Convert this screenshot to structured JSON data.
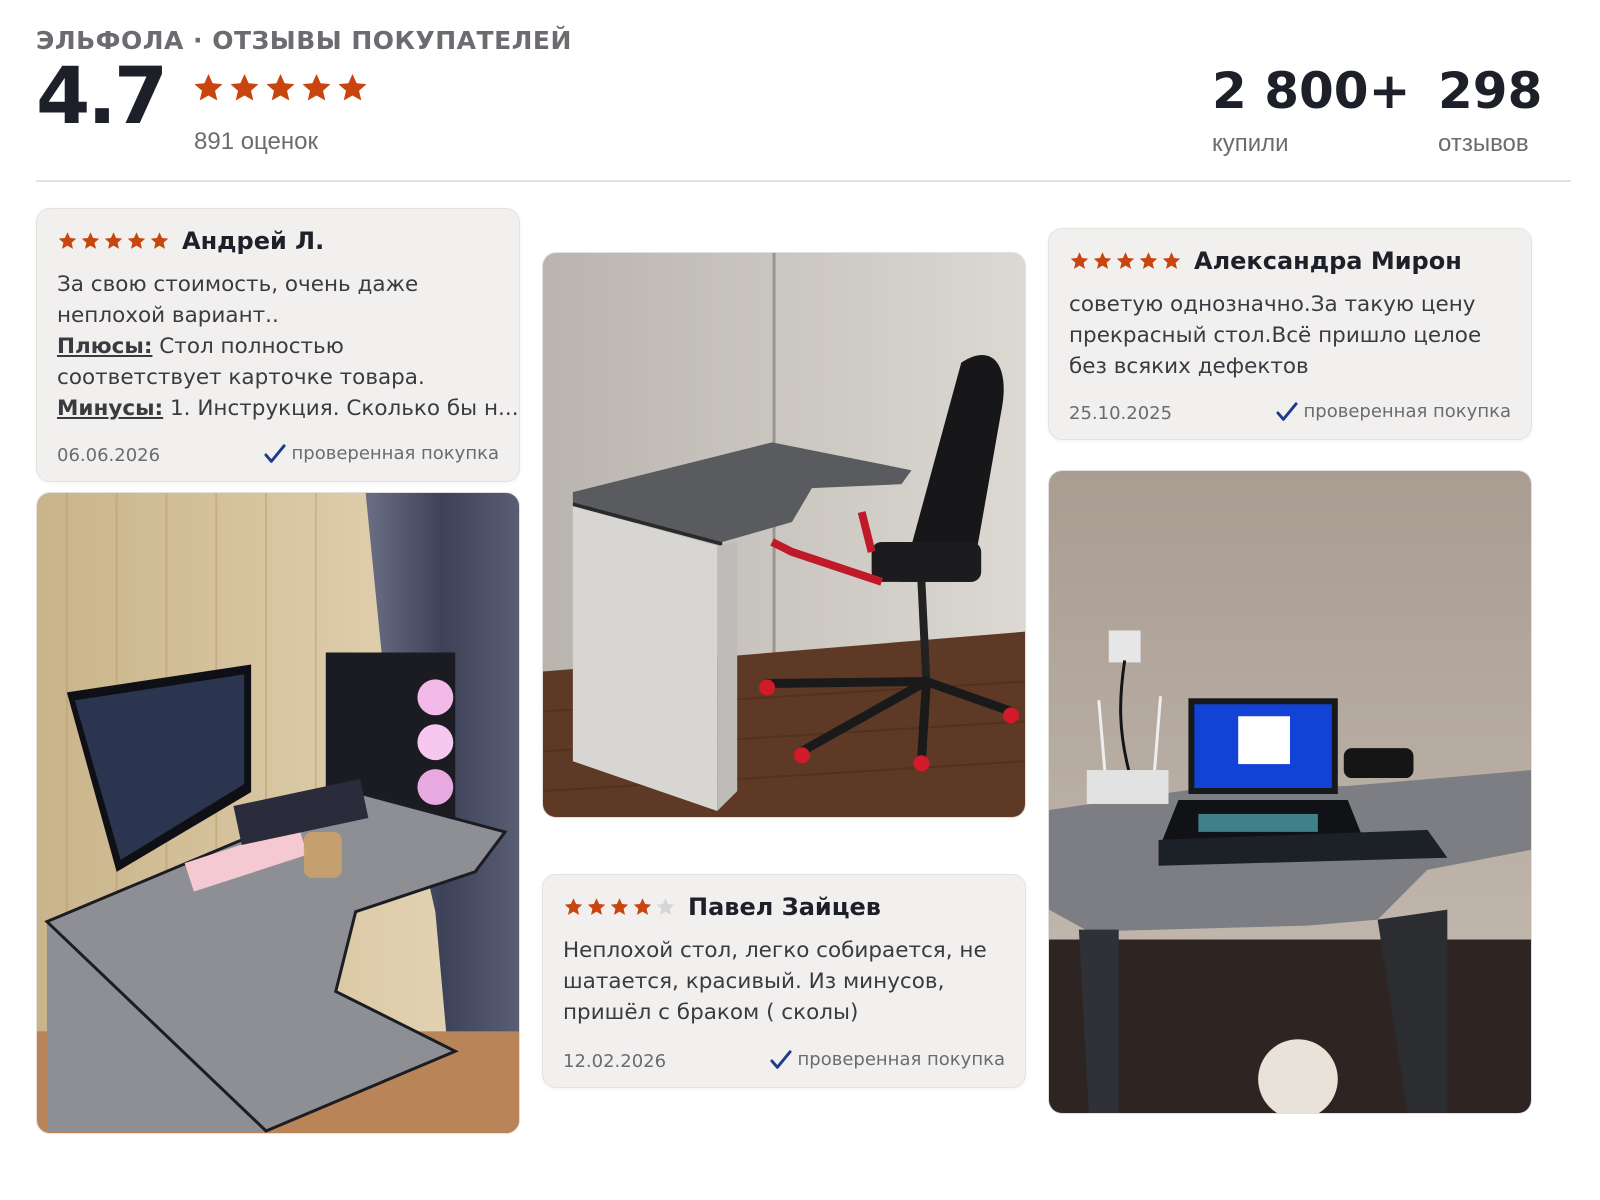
{
  "header": {
    "brand": "ЭЛЬФОЛА · ОТЗЫВЫ ПОКУПАТЕЛЕЙ",
    "score": "4.7",
    "stars": 5,
    "ratings_count": "891 оценок",
    "stats": [
      {
        "value": "2 800+",
        "label": "купили"
      },
      {
        "value": "298",
        "label": "отзывов"
      }
    ]
  },
  "colors": {
    "star": "#c9450f",
    "star_empty": "#d6d6d6",
    "check": "#1e3a8a",
    "card_bg": "#f1f0ee"
  },
  "reviews": [
    {
      "rating": 5,
      "author": "Андрей Л.",
      "text": "За свою стоимость, очень даже неплохой вариант..",
      "pros_label": "Плюсы:",
      "pros": "Стол полностью соответствует карточке товара.",
      "cons_label": "Минусы:",
      "cons": "1. Инструкция. Сколько бы н...",
      "date": "06.06.2026",
      "verified": "проверенная покупка"
    },
    {
      "rating": 4,
      "author": "Павел Зайцев",
      "text": "Неплохой стол, легко собирается, не шатается, красивый. Из минусов, пришёл с браком ( сколы)",
      "date": "12.02.2026",
      "verified": "проверенная покупка"
    },
    {
      "rating": 5,
      "author": "Александра Мирон",
      "text": "советую однозначно.За такую цену прекрасный стол.Всё пришло целое без всяких дефектов",
      "date": "25.10.2025",
      "verified": "проверенная покупка"
    }
  ],
  "photos": [
    {
      "name": "review-photo-gaming-setup",
      "icon": "photo"
    },
    {
      "name": "review-photo-desk-with-chair",
      "icon": "photo"
    },
    {
      "name": "review-photo-desk-with-laptop",
      "icon": "photo"
    }
  ]
}
